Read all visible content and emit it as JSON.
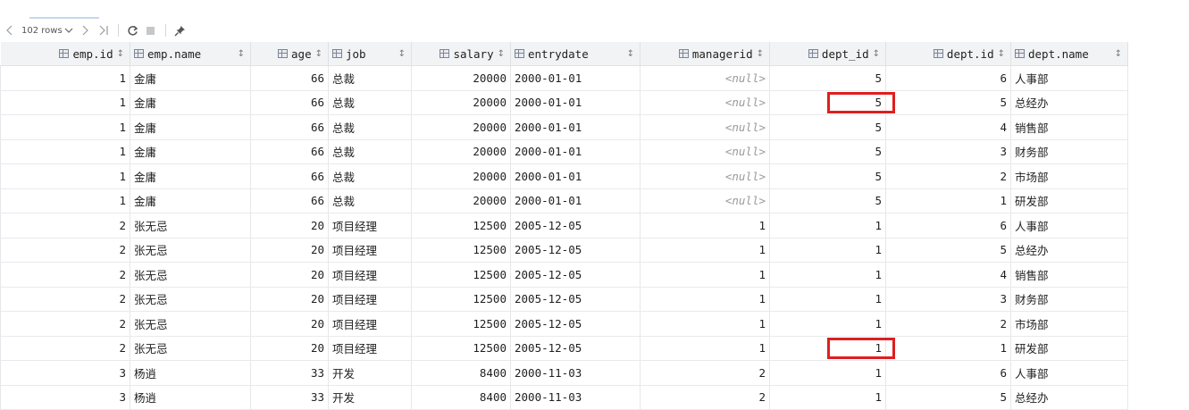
{
  "toolbar": {
    "prev_icon": "chevron-left-icon",
    "rows_label": "102 rows",
    "rows_dropdown_icon": "chevron-down-icon",
    "next_icon": "chevron-right-icon",
    "last_icon": "last-page-icon",
    "refresh_icon": "refresh-icon",
    "stop_icon": "stop-icon",
    "pin_icon": "pin-icon"
  },
  "columns": [
    {
      "name": "emp.id",
      "align": "right"
    },
    {
      "name": "emp.name",
      "align": "left"
    },
    {
      "name": "age",
      "align": "right"
    },
    {
      "name": "job",
      "align": "left"
    },
    {
      "name": "salary",
      "align": "right"
    },
    {
      "name": "entrydate",
      "align": "left"
    },
    {
      "name": "managerid",
      "align": "right"
    },
    {
      "name": "dept_id",
      "align": "right"
    },
    {
      "name": "dept.id",
      "align": "right"
    },
    {
      "name": "dept.name",
      "align": "left"
    }
  ],
  "rows": [
    [
      "1",
      "金庸",
      "66",
      "总裁",
      "20000",
      "2000-01-01",
      "<null>",
      "5",
      "6",
      "人事部"
    ],
    [
      "1",
      "金庸",
      "66",
      "总裁",
      "20000",
      "2000-01-01",
      "<null>",
      "5",
      "5",
      "总经办"
    ],
    [
      "1",
      "金庸",
      "66",
      "总裁",
      "20000",
      "2000-01-01",
      "<null>",
      "5",
      "4",
      "销售部"
    ],
    [
      "1",
      "金庸",
      "66",
      "总裁",
      "20000",
      "2000-01-01",
      "<null>",
      "5",
      "3",
      "财务部"
    ],
    [
      "1",
      "金庸",
      "66",
      "总裁",
      "20000",
      "2000-01-01",
      "<null>",
      "5",
      "2",
      "市场部"
    ],
    [
      "1",
      "金庸",
      "66",
      "总裁",
      "20000",
      "2000-01-01",
      "<null>",
      "5",
      "1",
      "研发部"
    ],
    [
      "2",
      "张无忌",
      "20",
      "项目经理",
      "12500",
      "2005-12-05",
      "1",
      "1",
      "6",
      "人事部"
    ],
    [
      "2",
      "张无忌",
      "20",
      "项目经理",
      "12500",
      "2005-12-05",
      "1",
      "1",
      "5",
      "总经办"
    ],
    [
      "2",
      "张无忌",
      "20",
      "项目经理",
      "12500",
      "2005-12-05",
      "1",
      "1",
      "4",
      "销售部"
    ],
    [
      "2",
      "张无忌",
      "20",
      "项目经理",
      "12500",
      "2005-12-05",
      "1",
      "1",
      "3",
      "财务部"
    ],
    [
      "2",
      "张无忌",
      "20",
      "项目经理",
      "12500",
      "2005-12-05",
      "1",
      "1",
      "2",
      "市场部"
    ],
    [
      "2",
      "张无忌",
      "20",
      "项目经理",
      "12500",
      "2005-12-05",
      "1",
      "1",
      "1",
      "研发部"
    ],
    [
      "3",
      "杨逍",
      "33",
      "开发",
      "8400",
      "2000-11-03",
      "2",
      "1",
      "6",
      "人事部"
    ],
    [
      "3",
      "杨逍",
      "33",
      "开发",
      "8400",
      "2000-11-03",
      "2",
      "1",
      "5",
      "总经办"
    ]
  ],
  "highlights": [
    {
      "row": 1,
      "color": "#e01e1e"
    },
    {
      "row": 11,
      "color": "#e01e1e"
    }
  ]
}
